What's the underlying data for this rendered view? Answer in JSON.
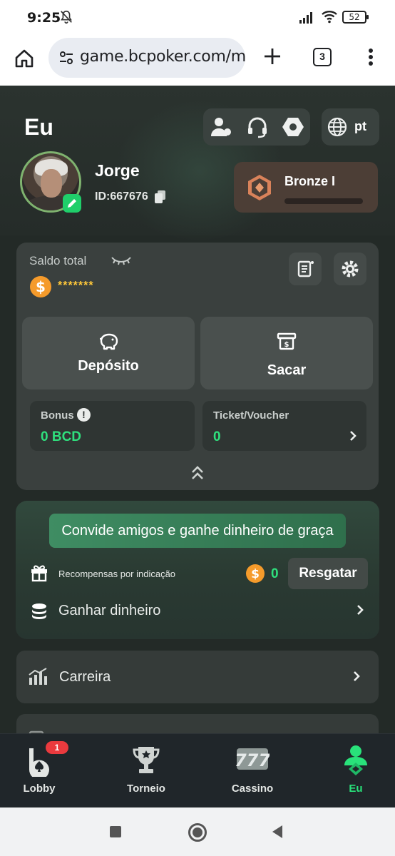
{
  "status_bar": {
    "time": "9:25",
    "battery": "52"
  },
  "browser": {
    "url": "game.bcpoker.com/m",
    "tab_count": "3"
  },
  "header": {
    "title": "Eu",
    "language": "pt"
  },
  "profile": {
    "name": "Jorge",
    "id_text": "ID:667676"
  },
  "rank": {
    "name": "Bronze I",
    "progress": 0
  },
  "wallet": {
    "label": "Saldo total",
    "balance_masked": "*******",
    "deposit_label": "Depósito",
    "withdraw_label": "Sacar",
    "bonus_label": "Bonus",
    "bonus_value": "0 BCD",
    "ticket_label": "Ticket/Voucher",
    "ticket_value": "0"
  },
  "invite": {
    "banner": "Convide amigos e ganhe dinheiro de graça",
    "referral_label": "Recompensas por indicação",
    "referral_value": "0",
    "redeem_label": "Resgatar",
    "earn_label": "Ganhar dinheiro"
  },
  "menu": {
    "career_label": "Carreira"
  },
  "bottom_nav": {
    "items": [
      {
        "label": "Lobby",
        "icon": "lobby-icon",
        "badge": "1"
      },
      {
        "label": "Torneio",
        "icon": "trophy-icon"
      },
      {
        "label": "Cassino",
        "icon": "slots-777-icon"
      },
      {
        "label": "Eu",
        "icon": "profile-icon",
        "active": true
      }
    ]
  },
  "colors": {
    "accent_green": "#2fe07d",
    "coin_orange": "#f59b2b",
    "background": "#232a27"
  }
}
